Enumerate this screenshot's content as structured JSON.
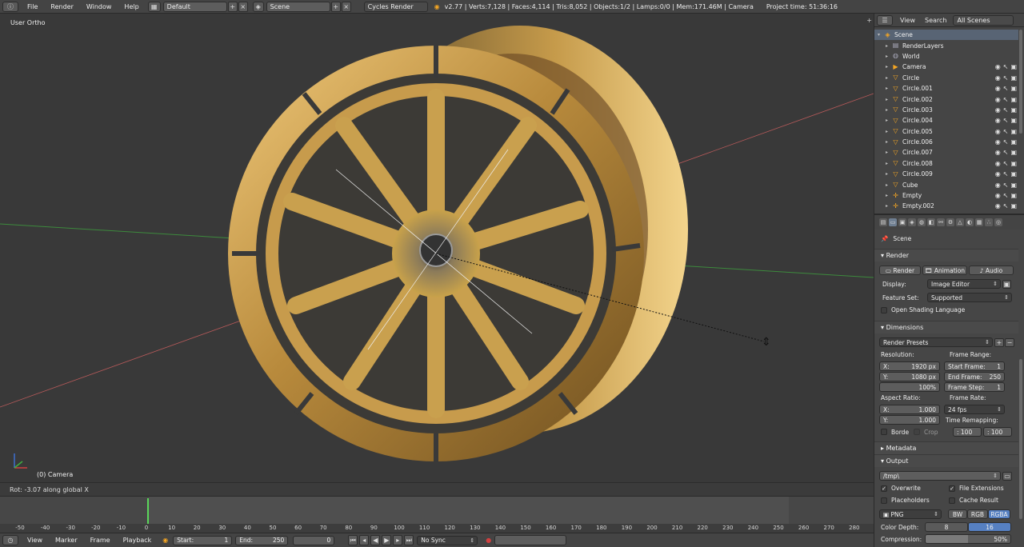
{
  "topbar": {
    "menus": [
      "File",
      "Render",
      "Window",
      "Help"
    ],
    "layout": "Default",
    "scene": "Scene",
    "engine": "Cycles Render",
    "stats": "v2.77 | Verts:7,128 | Faces:4,114 | Tris:8,052 | Objects:1/2 | Lamps:0/0 | Mem:171.46M | Camera",
    "project_time": "Project time: 51:36:16"
  },
  "viewport": {
    "view_label": "User Ortho",
    "object_label": "(0) Camera",
    "status": "Rot: -3.07 along global X"
  },
  "timeline": {
    "ticks": [
      "-50",
      "-40",
      "-30",
      "-20",
      "-10",
      "0",
      "10",
      "20",
      "30",
      "40",
      "50",
      "60",
      "70",
      "80",
      "90",
      "100",
      "110",
      "120",
      "130",
      "140",
      "150",
      "160",
      "170",
      "180",
      "190",
      "200",
      "210",
      "220",
      "230",
      "240",
      "250",
      "260",
      "270",
      "280"
    ],
    "menus": [
      "View",
      "Marker",
      "Frame",
      "Playback"
    ],
    "start_label": "Start:",
    "start_value": "1",
    "end_label": "End:",
    "end_value": "250",
    "current_frame": "0",
    "sync": "No Sync"
  },
  "outliner": {
    "menus": [
      "View",
      "Search"
    ],
    "filter": "All Scenes",
    "items": [
      {
        "label": "Scene",
        "icon": "scene-icon",
        "indent": 0,
        "selected": true
      },
      {
        "label": "RenderLayers",
        "icon": "renderlayers-icon",
        "indent": 1
      },
      {
        "label": "World",
        "icon": "world-icon",
        "indent": 1
      },
      {
        "label": "Camera",
        "icon": "camera-icon",
        "indent": 1
      },
      {
        "label": "Circle",
        "icon": "mesh-icon",
        "indent": 1
      },
      {
        "label": "Circle.001",
        "icon": "mesh-icon",
        "indent": 1
      },
      {
        "label": "Circle.002",
        "icon": "mesh-icon",
        "indent": 1
      },
      {
        "label": "Circle.003",
        "icon": "mesh-icon",
        "indent": 1
      },
      {
        "label": "Circle.004",
        "icon": "mesh-icon",
        "indent": 1
      },
      {
        "label": "Circle.005",
        "icon": "mesh-icon",
        "indent": 1
      },
      {
        "label": "Circle.006",
        "icon": "mesh-icon",
        "indent": 1
      },
      {
        "label": "Circle.007",
        "icon": "mesh-icon",
        "indent": 1
      },
      {
        "label": "Circle.008",
        "icon": "mesh-icon",
        "indent": 1
      },
      {
        "label": "Circle.009",
        "icon": "mesh-icon",
        "indent": 1
      },
      {
        "label": "Cube",
        "icon": "mesh-icon",
        "indent": 1
      },
      {
        "label": "Empty",
        "icon": "empty-icon",
        "indent": 1
      },
      {
        "label": "Empty.002",
        "icon": "empty-icon",
        "indent": 1
      }
    ]
  },
  "properties": {
    "context": "Scene",
    "render_section": "Render",
    "render_btn": "Render",
    "animation_btn": "Animation",
    "audio_btn": "Audio",
    "display_label": "Display:",
    "display_value": "Image Editor",
    "feature_label": "Feature Set:",
    "feature_value": "Supported",
    "osl_label": "Open Shading Language",
    "dimensions_section": "Dimensions",
    "presets": "Render Presets",
    "resolution_label": "Resolution:",
    "res_x_label": "X:",
    "res_x": "1920 px",
    "res_y_label": "Y:",
    "res_y": "1080 px",
    "res_pct": "100%",
    "frame_range_label": "Frame Range:",
    "start_frame_label": "Start Frame:",
    "start_frame": "1",
    "end_frame_label": "End Frame:",
    "end_frame": "250",
    "frame_step_label": "Frame Step:",
    "frame_step": "1",
    "aspect_label": "Aspect Ratio:",
    "asp_x_label": "X:",
    "asp_x": "1.000",
    "asp_y_label": "Y:",
    "asp_y": "1.000",
    "frame_rate_label": "Frame Rate:",
    "frame_rate": "24 fps",
    "border_label": "Borde",
    "crop_label": "Crop",
    "time_remap_label": "Time Remapping:",
    "remap_old": ": 100",
    "remap_new": ": 100",
    "metadata_section": "Metadata",
    "output_section": "Output",
    "output_path": "/tmp\\",
    "overwrite_label": "Overwrite",
    "file_ext_label": "File Extensions",
    "placeholders_label": "Placeholders",
    "cache_label": "Cache Result",
    "format": "PNG",
    "bw": "BW",
    "rgb": "RGB",
    "rgba": "RGBA",
    "color_depth_label": "Color Depth:",
    "depth_8": "8",
    "depth_16": "16",
    "compression_label": "Compression:",
    "compression": "50%"
  },
  "colors": {
    "accent_blue": "#5680c2",
    "gold": "#c9a24a",
    "timeline_cursor": "#5bd65b"
  }
}
